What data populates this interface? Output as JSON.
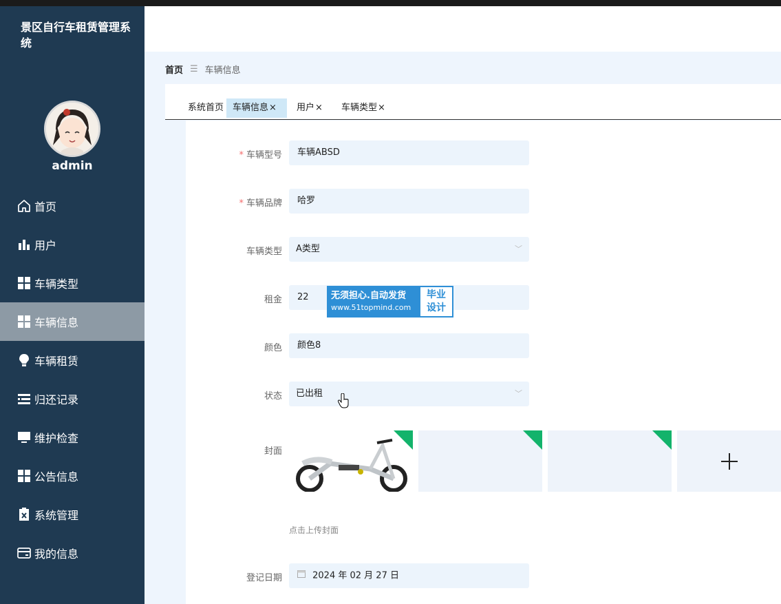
{
  "app": {
    "title": "景区自行车租赁管理系统"
  },
  "user": {
    "name": "admin"
  },
  "sidebar": {
    "items": [
      {
        "label": "首页",
        "icon": "home-icon"
      },
      {
        "label": "用户",
        "icon": "bar-chart-icon"
      },
      {
        "label": "车辆类型",
        "icon": "grid-icon"
      },
      {
        "label": "车辆信息",
        "icon": "grid-icon",
        "active": true
      },
      {
        "label": "车辆租赁",
        "icon": "bulb-icon"
      },
      {
        "label": "归还记录",
        "icon": "list-icon"
      },
      {
        "label": "维护检查",
        "icon": "monitor-icon"
      },
      {
        "label": "公告信息",
        "icon": "grid-icon"
      },
      {
        "label": "系统管理",
        "icon": "clipboard-icon"
      },
      {
        "label": "我的信息",
        "icon": "card-icon"
      }
    ]
  },
  "breadcrumb": {
    "home": "首页",
    "sep": "☰",
    "current": "车辆信息"
  },
  "tabs": [
    {
      "label": "系统首页",
      "closable": false
    },
    {
      "label": "车辆信息",
      "closable": true,
      "active": true
    },
    {
      "label": "用户",
      "closable": true
    },
    {
      "label": "车辆类型",
      "closable": true
    }
  ],
  "tab_close": "×",
  "form": {
    "model": {
      "label": "车辆型号",
      "value": "车辆ABSD",
      "required": true
    },
    "brand": {
      "label": "车辆品牌",
      "value": "哈罗",
      "required": true
    },
    "type": {
      "label": "车辆类型",
      "value": "A类型"
    },
    "rent": {
      "label": "租金",
      "value": "22"
    },
    "color": {
      "label": "颜色",
      "value": "颜色8"
    },
    "status": {
      "label": "状态",
      "value": "已出租"
    },
    "cover": {
      "label": "封面",
      "hint": "点击上传封面"
    },
    "date": {
      "label": "登记日期",
      "value": "2024 年 02 月 27 日"
    }
  },
  "required_mark": "*",
  "watermark": {
    "line1": "无须担心.自动发货",
    "line2": "www.51topmind.com",
    "right1": "毕业",
    "right2": "设计"
  },
  "colors": {
    "sidebar": "#1f3a52",
    "active_item": "#8d9aa5",
    "input_bg": "#ecf4fc",
    "accent_green": "#13b36b"
  }
}
